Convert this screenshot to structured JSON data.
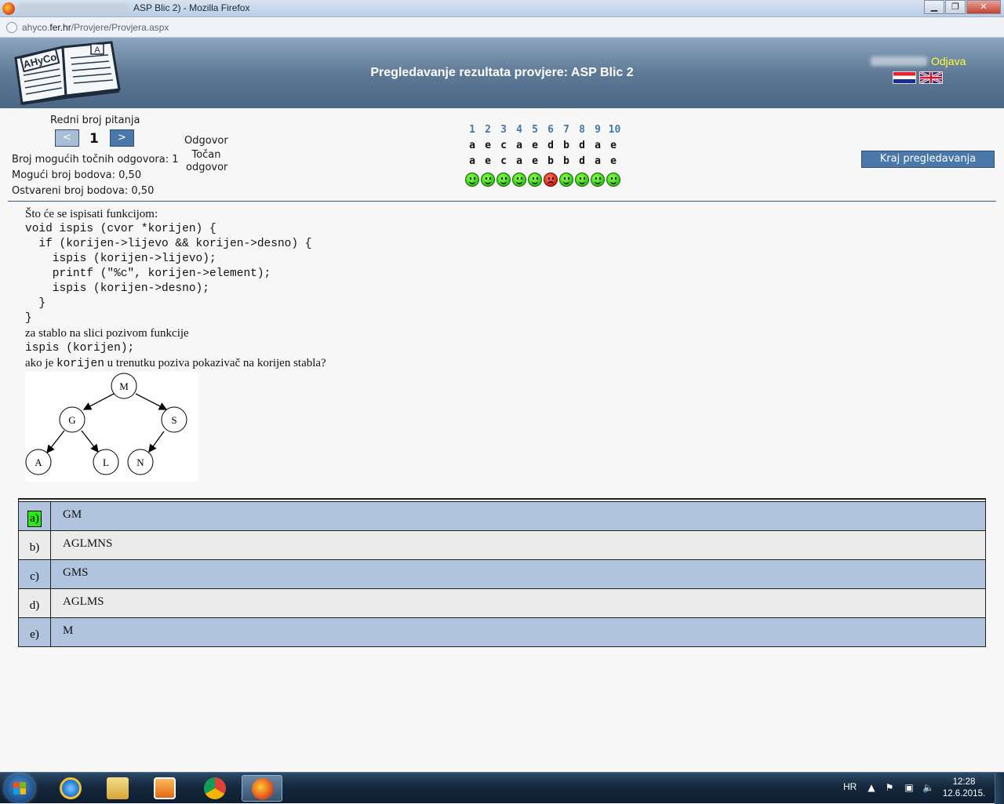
{
  "browser": {
    "window_title": "ASP Blic 2) - Mozilla Firefox",
    "url_prefix": "ahyco.",
    "url_domain": "fer.hr",
    "url_path": "/Provjere/Provjera.aspx"
  },
  "header": {
    "title": "Pregledavanje rezultata provjere: ASP Blic 2",
    "logout_label": "Odjava",
    "logo_text": "AHyCo",
    "logo_badge": "A"
  },
  "question_nav": {
    "label": "Redni broj pitanja",
    "prev_label": "<",
    "next_label": ">",
    "current": "1",
    "answer_label": "Odgovor",
    "correct_label": "Točan odgovor"
  },
  "stats": {
    "possible_correct": "Broj mogućih točnih odgovora: 1",
    "possible_points": "Mogući broj bodova: 0,50",
    "earned_points": "Ostvareni broj bodova: 0,50"
  },
  "overview": {
    "numbers": [
      "1",
      "2",
      "3",
      "4",
      "5",
      "6",
      "7",
      "8",
      "9",
      "10"
    ],
    "answers": [
      "a",
      "e",
      "c",
      "a",
      "e",
      "d",
      "b",
      "d",
      "a",
      "e"
    ],
    "correct": [
      "a",
      "e",
      "c",
      "a",
      "e",
      "b",
      "b",
      "d",
      "a",
      "e"
    ],
    "status": [
      "ok",
      "ok",
      "ok",
      "ok",
      "ok",
      "bad",
      "ok",
      "ok",
      "ok",
      "ok"
    ]
  },
  "end_button_label": "Kraj pregledavanja",
  "question": {
    "intro": "Što će se ispisati funkcijom:",
    "code": [
      "void ispis (cvor *korijen) {",
      "  if (korijen->lijevo && korijen->desno) {",
      "    ispis (korijen->lijevo);",
      "    printf (\"%c\", korijen->element);",
      "    ispis (korijen->desno);",
      "  }",
      "}"
    ],
    "middle": "za stablo na slici pozivom funkcije",
    "call": "ispis (korijen);",
    "outro_a": "ako je ",
    "outro_code": "korijen",
    "outro_b": " u trenutku poziva pokazivač na korijen stabla?",
    "tree_nodes": [
      "M",
      "G",
      "S",
      "A",
      "L",
      "N"
    ]
  },
  "answers": [
    {
      "letter": "a)",
      "text": "GM",
      "correct": true
    },
    {
      "letter": "b)",
      "text": "AGLMNS",
      "correct": false
    },
    {
      "letter": "c)",
      "text": "GMS",
      "correct": false
    },
    {
      "letter": "d)",
      "text": "AGLMS",
      "correct": false
    },
    {
      "letter": "e)",
      "text": "M",
      "correct": false
    }
  ],
  "taskbar": {
    "language": "HR",
    "time": "12:28",
    "date": "12.6.2015."
  }
}
